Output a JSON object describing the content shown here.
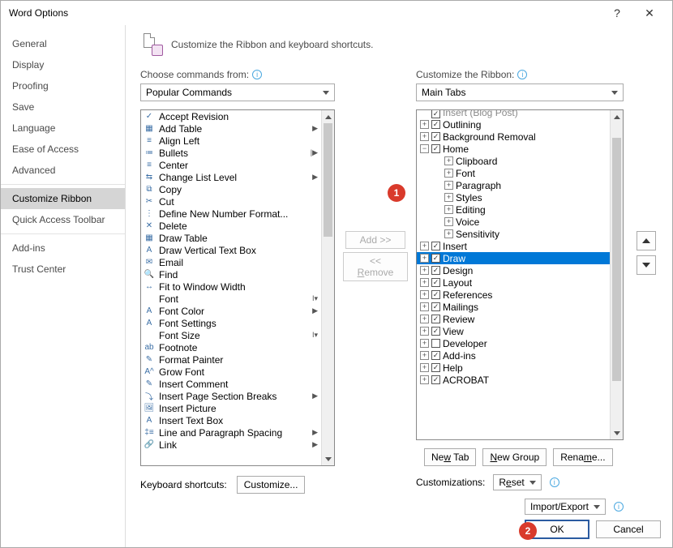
{
  "title": "Word Options",
  "sidebar": {
    "items": [
      "General",
      "Display",
      "Proofing",
      "Save",
      "Language",
      "Ease of Access",
      "Advanced"
    ],
    "items2": [
      "Customize Ribbon",
      "Quick Access Toolbar"
    ],
    "items3": [
      "Add-ins",
      "Trust Center"
    ],
    "selected": "Customize Ribbon"
  },
  "header": "Customize the Ribbon and keyboard shortcuts.",
  "left": {
    "label": "Choose commands from:",
    "dropdown": "Popular Commands",
    "commands": [
      {
        "icon": "✓",
        "label": "Accept Revision"
      },
      {
        "icon": "▦",
        "label": "Add Table",
        "sub": "▶"
      },
      {
        "icon": "≡",
        "label": "Align Left"
      },
      {
        "icon": "≔",
        "label": "Bullets",
        "sub": "|▶"
      },
      {
        "icon": "≡",
        "label": "Center"
      },
      {
        "icon": "⇆",
        "label": "Change List Level",
        "sub": "▶"
      },
      {
        "icon": "⧉",
        "label": "Copy"
      },
      {
        "icon": "✂",
        "label": "Cut"
      },
      {
        "icon": "⋮",
        "label": "Define New Number Format..."
      },
      {
        "icon": "✕",
        "label": "Delete"
      },
      {
        "icon": "▦",
        "label": "Draw Table"
      },
      {
        "icon": "A",
        "label": "Draw Vertical Text Box"
      },
      {
        "icon": "✉",
        "label": "Email"
      },
      {
        "icon": "🔍",
        "label": "Find"
      },
      {
        "icon": "↔",
        "label": "Fit to Window Width"
      },
      {
        "icon": "",
        "label": "Font",
        "sub": "I▾"
      },
      {
        "icon": "A",
        "label": "Font Color",
        "sub": "▶"
      },
      {
        "icon": "A",
        "label": "Font Settings"
      },
      {
        "icon": "",
        "label": "Font Size",
        "sub": "I▾"
      },
      {
        "icon": "ab",
        "label": "Footnote"
      },
      {
        "icon": "✎",
        "label": "Format Painter"
      },
      {
        "icon": "A^",
        "label": "Grow Font"
      },
      {
        "icon": "✎",
        "label": "Insert Comment"
      },
      {
        "icon": "⤵",
        "label": "Insert Page  Section Breaks",
        "sub": "▶"
      },
      {
        "icon": "🖼",
        "label": "Insert Picture"
      },
      {
        "icon": "A",
        "label": "Insert Text Box"
      },
      {
        "icon": "‡≡",
        "label": "Line and Paragraph Spacing",
        "sub": "▶"
      },
      {
        "icon": "🔗",
        "label": "Link",
        "sub": "▶"
      }
    ],
    "kb_label": "Keyboard shortcuts:",
    "kb_btn": "Customize..."
  },
  "mid": {
    "add": "Add >>",
    "remove": "<< Remove"
  },
  "right": {
    "label": "Customize the Ribbon:",
    "dropdown": "Main Tabs",
    "tree_top": "Insert (Blog Post)",
    "tree": [
      {
        "ind": 1,
        "tw": "+",
        "cb": true,
        "label": "Outlining"
      },
      {
        "ind": 1,
        "tw": "+",
        "cb": true,
        "label": "Background Removal"
      },
      {
        "ind": 1,
        "tw": "−",
        "cb": true,
        "label": "Home"
      },
      {
        "ind": 2,
        "tw": "+",
        "cb": null,
        "label": "Clipboard"
      },
      {
        "ind": 2,
        "tw": "+",
        "cb": null,
        "label": "Font"
      },
      {
        "ind": 2,
        "tw": "+",
        "cb": null,
        "label": "Paragraph"
      },
      {
        "ind": 2,
        "tw": "+",
        "cb": null,
        "label": "Styles"
      },
      {
        "ind": 2,
        "tw": "+",
        "cb": null,
        "label": "Editing"
      },
      {
        "ind": 2,
        "tw": "+",
        "cb": null,
        "label": "Voice"
      },
      {
        "ind": 2,
        "tw": "+",
        "cb": null,
        "label": "Sensitivity"
      },
      {
        "ind": 1,
        "tw": "+",
        "cb": true,
        "label": "Insert"
      },
      {
        "ind": 1,
        "tw": "+",
        "cb": true,
        "label": "Draw",
        "selected": true
      },
      {
        "ind": 1,
        "tw": "+",
        "cb": true,
        "label": "Design"
      },
      {
        "ind": 1,
        "tw": "+",
        "cb": true,
        "label": "Layout"
      },
      {
        "ind": 1,
        "tw": "+",
        "cb": true,
        "label": "References"
      },
      {
        "ind": 1,
        "tw": "+",
        "cb": true,
        "label": "Mailings"
      },
      {
        "ind": 1,
        "tw": "+",
        "cb": true,
        "label": "Review"
      },
      {
        "ind": 1,
        "tw": "+",
        "cb": true,
        "label": "View"
      },
      {
        "ind": 1,
        "tw": "+",
        "cb": false,
        "label": "Developer"
      },
      {
        "ind": 1,
        "tw": "+",
        "cb": true,
        "label": "Add-ins"
      },
      {
        "ind": 1,
        "tw": "+",
        "cb": true,
        "label": "Help"
      },
      {
        "ind": 1,
        "tw": "+",
        "cb": true,
        "label": "ACROBAT"
      }
    ],
    "btns": {
      "newtab": "New Tab",
      "newgroup": "New Group",
      "rename": "Rename..."
    },
    "cust_label": "Customizations:",
    "reset": "Reset",
    "import": "Import/Export"
  },
  "footer": {
    "ok": "OK",
    "cancel": "Cancel"
  },
  "callouts": {
    "c1": "1",
    "c2": "2"
  }
}
